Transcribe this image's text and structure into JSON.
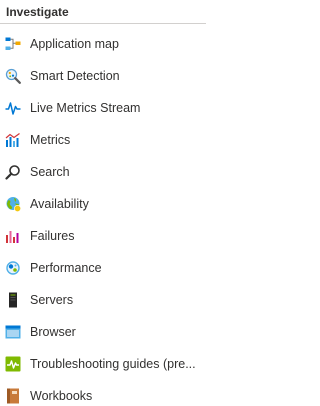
{
  "section": {
    "title": "Investigate"
  },
  "nav": {
    "items": [
      {
        "label": "Application map",
        "icon": "application-map-icon"
      },
      {
        "label": "Smart Detection",
        "icon": "smart-detection-icon"
      },
      {
        "label": "Live Metrics Stream",
        "icon": "live-metrics-icon"
      },
      {
        "label": "Metrics",
        "icon": "metrics-icon"
      },
      {
        "label": "Search",
        "icon": "search-icon"
      },
      {
        "label": "Availability",
        "icon": "availability-icon"
      },
      {
        "label": "Failures",
        "icon": "failures-icon"
      },
      {
        "label": "Performance",
        "icon": "performance-icon"
      },
      {
        "label": "Servers",
        "icon": "servers-icon"
      },
      {
        "label": "Browser",
        "icon": "browser-icon"
      },
      {
        "label": "Troubleshooting guides (pre...",
        "icon": "troubleshooting-guides-icon"
      },
      {
        "label": "Workbooks",
        "icon": "workbooks-icon"
      }
    ]
  }
}
